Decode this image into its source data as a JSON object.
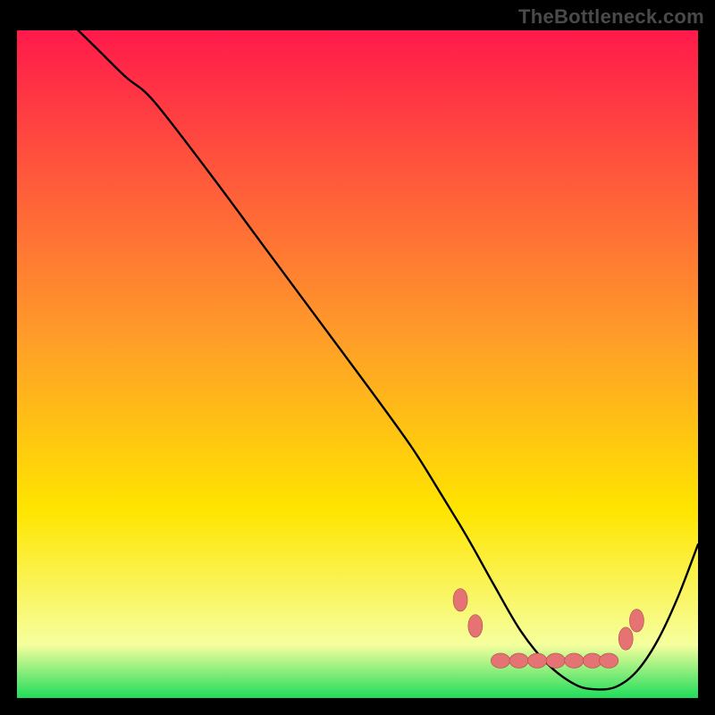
{
  "watermark": {
    "text": "TheBottleneck.com"
  },
  "chart_data": {
    "type": "line",
    "title": "",
    "xlabel": "",
    "ylabel": "",
    "xlim": [
      0,
      100
    ],
    "ylim": [
      0,
      100
    ],
    "series": [
      {
        "name": "curve",
        "x": [
          9,
          12,
          16,
          20,
          28,
          36,
          44,
          52,
          58,
          62,
          65,
          67,
          70,
          74,
          78,
          82,
          85,
          88,
          91,
          94,
          97,
          100
        ],
        "y": [
          100,
          97,
          93,
          89.5,
          79,
          68,
          57,
          46,
          37.5,
          31,
          26,
          22.5,
          17,
          10,
          5,
          2,
          1.3,
          1.7,
          4,
          8.5,
          15,
          23
        ]
      }
    ],
    "markers": [
      {
        "name": "dot-left-upper",
        "x": 65.1,
        "y": 14.7,
        "rx": 1.05,
        "ry": 1.7
      },
      {
        "name": "dot-left-lower",
        "x": 67.3,
        "y": 10.8,
        "rx": 1.05,
        "ry": 1.7
      },
      {
        "name": "strip-1",
        "x": 71.0,
        "y": 5.6,
        "rx": 1.4,
        "ry": 1.1
      },
      {
        "name": "strip-2",
        "x": 73.7,
        "y": 5.6,
        "rx": 1.4,
        "ry": 1.1
      },
      {
        "name": "strip-3",
        "x": 76.4,
        "y": 5.6,
        "rx": 1.4,
        "ry": 1.1
      },
      {
        "name": "strip-4",
        "x": 79.1,
        "y": 5.6,
        "rx": 1.4,
        "ry": 1.1
      },
      {
        "name": "strip-5",
        "x": 81.8,
        "y": 5.6,
        "rx": 1.4,
        "ry": 1.1
      },
      {
        "name": "strip-6",
        "x": 84.5,
        "y": 5.6,
        "rx": 1.4,
        "ry": 1.1
      },
      {
        "name": "strip-7",
        "x": 86.9,
        "y": 5.6,
        "rx": 1.4,
        "ry": 1.1
      },
      {
        "name": "dot-right-eye",
        "x": 89.4,
        "y": 8.9,
        "rx": 1.05,
        "ry": 1.7
      },
      {
        "name": "dot-right-upper",
        "x": 91.0,
        "y": 11.6,
        "rx": 1.05,
        "ry": 1.7
      }
    ],
    "colors": {
      "gradient_top": "#ff1a4b",
      "gradient_mid": "#ffe500",
      "gradient_low": "#f6ff9e",
      "gradient_bottom": "#1fdc5a",
      "curve": "#000000",
      "marker_fill": "#e57373",
      "marker_stroke": "#b04a4a"
    }
  }
}
